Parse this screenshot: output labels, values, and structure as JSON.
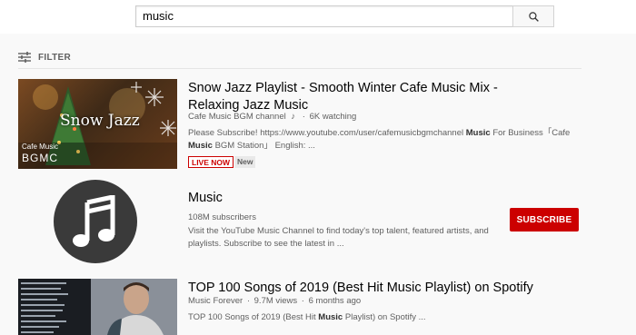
{
  "search": {
    "query": "music"
  },
  "filter": {
    "label": "FILTER"
  },
  "results": [
    {
      "title": "Snow Jazz Playlist - Smooth Winter Cafe Music Mix - Relaxing Jazz Music",
      "channel": "Cafe Music BGM channel",
      "channel_icon": "music-note-icon",
      "watching": "6K watching",
      "desc_line1_a": "Please Subscribe! https://www.youtube.com/user/cafemusicbgmchannel ",
      "desc_line1_b": "Music",
      "desc_line1_c": " For Business「Cafe",
      "desc_line2_a": "Music",
      "desc_line2_b": " BGM Station」 English: ...",
      "badge_live": "LIVE NOW",
      "badge_new": "New",
      "thumb_text": "Snow Jazz",
      "thumb_logo_top": "Cafe Music",
      "thumb_logo_bottom": "BGMC"
    },
    {
      "title": "Music",
      "subscribers": "108M subscribers",
      "desc_line1": "Visit the YouTube Music Channel to find today's top talent, featured artists, and",
      "desc_line2": "playlists. Subscribe to see the latest in ...",
      "subscribe_label": "SUBSCRIBE"
    },
    {
      "title": "TOP 100 Songs of 2019 (Best Hit Music Playlist) on Spotify",
      "channel": "Music Forever",
      "views": "9.7M views",
      "age": "6 months ago",
      "desc_a": "TOP 100 Songs of 2019 (Best Hit ",
      "desc_b": "Music",
      "desc_c": " Playlist) on Spotify ..."
    }
  ],
  "colors": {
    "accent": "#cc0000",
    "background": "#f9f9f9",
    "secondary_text": "#606060"
  }
}
